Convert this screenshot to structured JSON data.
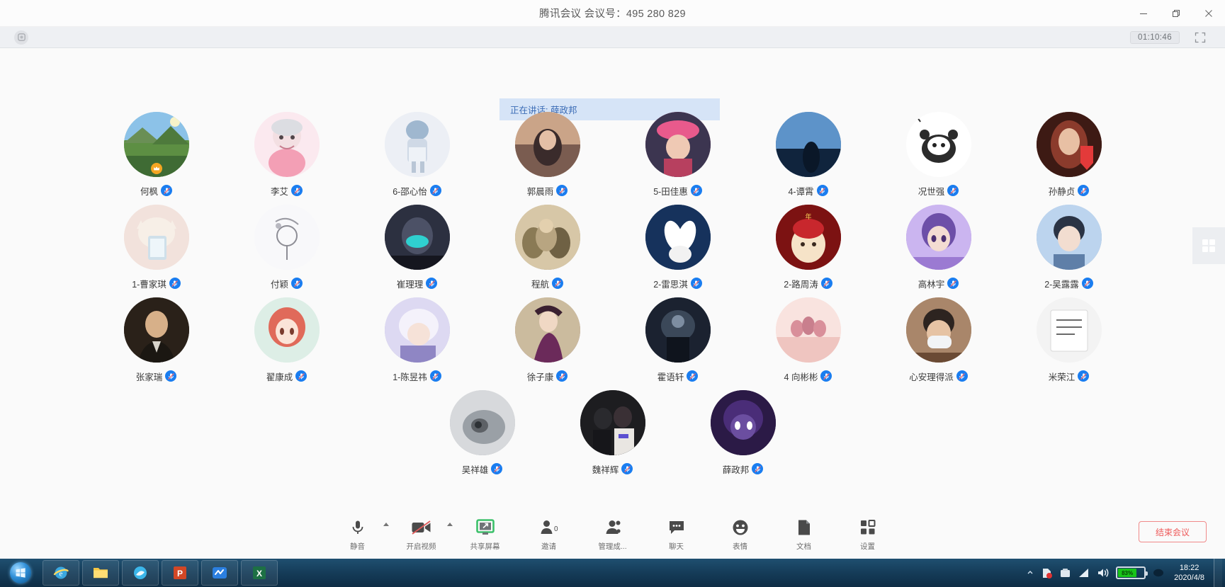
{
  "window": {
    "title": "腾讯会议 会议号：495 280 829",
    "minimize": "—",
    "restore": "❐",
    "close": "✕"
  },
  "topbar": {
    "timer": "01:10:46",
    "record_icon": "record-icon",
    "fullscreen_icon": "fullscreen-icon"
  },
  "stage": {
    "speaking_banner": "正在讲话: 薛政邦",
    "side_handle_icon": "grid-layout-icon"
  },
  "participants": [
    {
      "name": "何枫",
      "muted": true,
      "host": true,
      "bg": "linear-gradient(180deg,#8fc3e8 0%,#6fa85f 55%,#3f6b34 100%)",
      "art": "landscape"
    },
    {
      "name": "李艾",
      "muted": true,
      "host": false,
      "bg": "#fbe9ef",
      "art": "granny"
    },
    {
      "name": "6-邵心怡",
      "muted": true,
      "host": false,
      "bg": "#eceff5",
      "art": "girl-sketch"
    },
    {
      "name": "郭晨雨",
      "muted": true,
      "host": false,
      "bg": "linear-gradient(180deg,#caa488 0%,#5b3f3a 100%)",
      "art": "portrait"
    },
    {
      "name": "5-田佳惠",
      "muted": true,
      "host": false,
      "bg": "linear-gradient(180deg,#e85a8c 0%,#3c3550 100%)",
      "art": "pinkhat"
    },
    {
      "name": "4-谭霄",
      "muted": true,
      "host": false,
      "bg": "linear-gradient(180deg,#5d93c9 0%,#10243d 100%)",
      "art": "night"
    },
    {
      "name": "况世强",
      "muted": true,
      "host": false,
      "bg": "#ffffff",
      "art": "panda"
    },
    {
      "name": "孙静贞",
      "muted": true,
      "host": false,
      "bg": "linear-gradient(180deg,#7a3a2e 0%,#3d1a14 100%)",
      "art": "redhair"
    },
    {
      "name": "1-曹家琪",
      "muted": true,
      "host": false,
      "bg": "#f2e2dc",
      "art": "cat-phone"
    },
    {
      "name": "付颖",
      "muted": true,
      "host": false,
      "bg": "#f7f7f9",
      "art": "line-art"
    },
    {
      "name": "崔理理",
      "muted": true,
      "host": false,
      "bg": "linear-gradient(180deg,#4a4f63 0%,#15161f 100%)",
      "art": "mask"
    },
    {
      "name": "程航",
      "muted": true,
      "host": false,
      "bg": "linear-gradient(180deg,#d7c7a7 0%,#8a7a55 100%)",
      "art": "group"
    },
    {
      "name": "2-雷思淇",
      "muted": true,
      "host": false,
      "bg": "#16325c",
      "art": "rabbit"
    },
    {
      "name": "2-路周涛",
      "muted": true,
      "host": false,
      "bg": "linear-gradient(180deg,#9b1b1b 0%,#5a0d0d 100%)",
      "art": "kid-red"
    },
    {
      "name": "高林宇",
      "muted": true,
      "host": false,
      "bg": "linear-gradient(180deg,#cbb5f0 0%,#6d4fa8 100%)",
      "art": "anime-purple"
    },
    {
      "name": "2-吴露露",
      "muted": true,
      "host": false,
      "bg": "linear-gradient(180deg,#bcd4ee 0%,#5f7fa8 100%)",
      "art": "anime-boy"
    },
    {
      "name": "张家瑞",
      "muted": true,
      "host": false,
      "bg": "linear-gradient(180deg,#3c3226 0%,#16110c 100%)",
      "art": "suit"
    },
    {
      "name": "翟康成",
      "muted": true,
      "host": false,
      "bg": "#ddeee6",
      "art": "anime-red"
    },
    {
      "name": "1-陈昱祎",
      "muted": true,
      "host": false,
      "bg": "linear-gradient(180deg,#d9d6ee 0%,#8f86c4 100%)",
      "art": "anime-white"
    },
    {
      "name": "徐子康",
      "muted": true,
      "host": false,
      "bg": "linear-gradient(180deg,#d8c8ad 0%,#6b2a5a 100%)",
      "art": "purple-dress"
    },
    {
      "name": "霍语轩",
      "muted": true,
      "host": false,
      "bg": "linear-gradient(180deg,#2b3544 0%,#0d1119 100%)",
      "art": "dark-scene"
    },
    {
      "name": "4 向彬彬",
      "muted": true,
      "host": false,
      "bg": "#f6dcd8",
      "art": "pink-girls"
    },
    {
      "name": "心安理得派",
      "muted": true,
      "host": false,
      "bg": "linear-gradient(180deg,#c09b7a 0%,#6a4a34 100%)",
      "art": "mask-person"
    },
    {
      "name": "米荣江",
      "muted": true,
      "host": false,
      "bg": "#f4f4f4",
      "art": "paper"
    },
    {
      "name": "吴祥雄",
      "muted": true,
      "host": false,
      "bg": "linear-gradient(180deg,#d7d9dc 0%,#8d9196 100%)",
      "art": "gray-art"
    },
    {
      "name": "魏祥辉",
      "muted": true,
      "host": false,
      "bg": "linear-gradient(180deg,#2c2c30 0%,#101012 100%)",
      "art": "two-people"
    },
    {
      "name": "薛政邦",
      "muted": true,
      "host": false,
      "bg": "linear-gradient(180deg,#3b2358 0%,#140d21 100%)",
      "art": "purple-anime"
    }
  ],
  "toolbar": {
    "items": [
      {
        "label": "静音",
        "icon": "microphone-icon",
        "caret": true
      },
      {
        "label": "开启视频",
        "icon": "video-off-icon",
        "caret": true
      },
      {
        "label": "共享屏幕",
        "icon": "share-screen-icon",
        "caret": false
      },
      {
        "label": "邀请",
        "icon": "invite-icon",
        "caret": false
      },
      {
        "label": "管理成...",
        "icon": "manage-members-icon",
        "caret": false
      },
      {
        "label": "聊天",
        "icon": "chat-icon",
        "caret": false
      },
      {
        "label": "表情",
        "icon": "emoji-icon",
        "caret": false
      },
      {
        "label": "文档",
        "icon": "document-icon",
        "caret": false
      },
      {
        "label": "设置",
        "icon": "settings-grid-icon",
        "caret": false
      }
    ],
    "end_meeting": "结束会议"
  },
  "taskbar": {
    "start_icon": "windows-start-orb",
    "pinned": [
      {
        "icon": "internet-explorer-icon"
      },
      {
        "icon": "file-explorer-icon"
      },
      {
        "icon": "browser-icon"
      },
      {
        "icon": "powerpoint-icon"
      },
      {
        "icon": "meeting-app-icon"
      },
      {
        "icon": "excel-icon"
      }
    ],
    "battery_percent": "83%",
    "clock_time": "18:22",
    "clock_date": "2020/4/8"
  },
  "colors": {
    "accent_blue": "#1a7df0",
    "banner_bg": "#d6e4f7",
    "banner_text": "#3a6bb5",
    "end_red": "#ee5a5a",
    "taskbar": "#143a56"
  }
}
